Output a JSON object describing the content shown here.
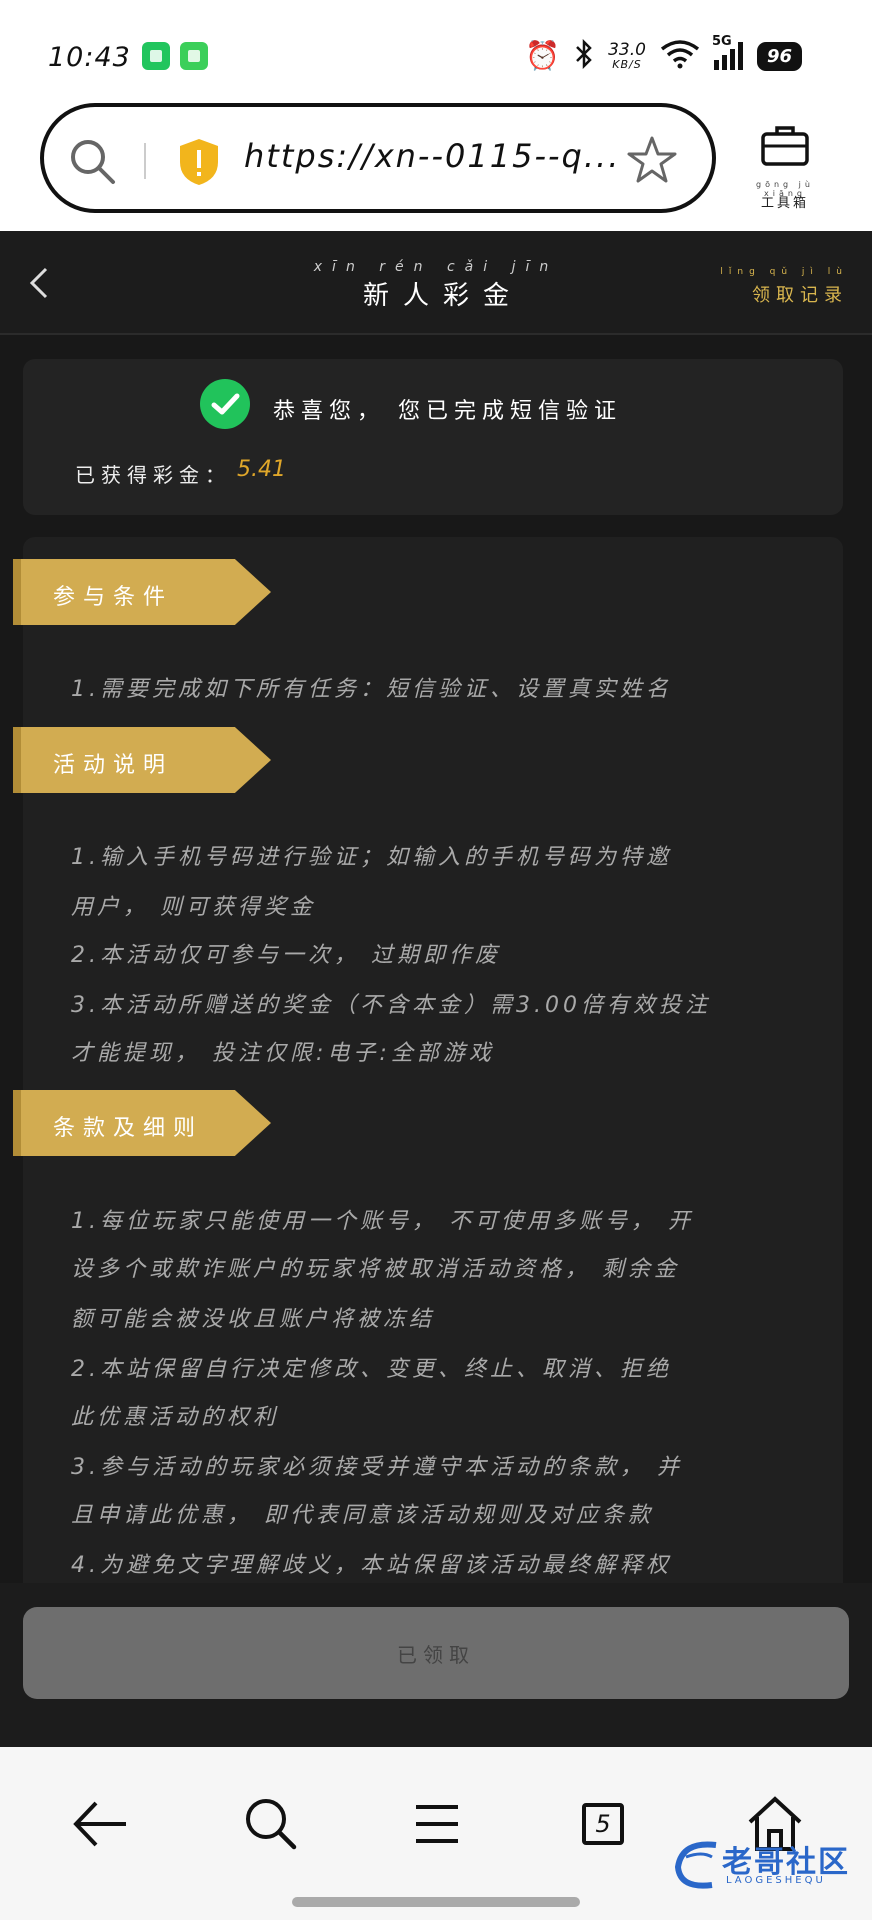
{
  "status_bar": {
    "time": "10:43",
    "net_speed": "33.0",
    "net_unit": "KB/S",
    "network": "5G",
    "battery": "96"
  },
  "browser": {
    "url": "https://xn--0115--q...",
    "toolbox_label": "工具箱",
    "toolbox_pinyin": "gōng jù xiāng"
  },
  "header": {
    "title": "新人彩金",
    "title_pinyin": "xīn rén cǎi jīn",
    "history_link": "领取记录",
    "history_pinyin": "lǐng qǔ jì lù"
  },
  "success_card": {
    "message": "恭喜您， 您已完成短信验证",
    "reward_label": "已获得彩金：",
    "reward_value": "5.41"
  },
  "sections": {
    "conditions": {
      "title": "参与条件",
      "lines": [
        "1.需要完成如下所有任务：短信验证、设置真实姓名"
      ]
    },
    "description": {
      "title": "活动说明",
      "lines": [
        "1.输入手机号码进行验证；如输入的手机号码为特邀",
        "用户， 则可获得奖金",
        "2.本活动仅可参与一次， 过期即作废",
        "3.本活动所赠送的奖金（不含本金）需3.00倍有效投注",
        "才能提现， 投注仅限:电子:全部游戏"
      ]
    },
    "terms": {
      "title": "条款及细则",
      "lines": [
        "1.每位玩家只能使用一个账号， 不可使用多账号， 开",
        "设多个或欺诈账户的玩家将被取消活动资格， 剩余金",
        "额可能会被没收且账户将被冻结",
        "2.本站保留自行决定修改、变更、终止、取消、拒绝",
        "此优惠活动的权利",
        "3.参与活动的玩家必须接受并遵守本活动的条款， 并",
        "且申请此优惠， 即代表同意该活动规则及对应条款",
        "4.为避免文字理解歧义，本站保留该活动最终解释权"
      ]
    }
  },
  "claim_button": {
    "label": "已领取"
  },
  "bottom_nav": {
    "tab_count": "5"
  },
  "watermark": {
    "text": "老哥社区",
    "sub": "LAOGESHEQU"
  },
  "colors": {
    "accent_gold": "#d2ac51",
    "reward_orange": "#e0a72a",
    "success_green": "#21c35b",
    "shield_yellow": "#f2b51c"
  }
}
